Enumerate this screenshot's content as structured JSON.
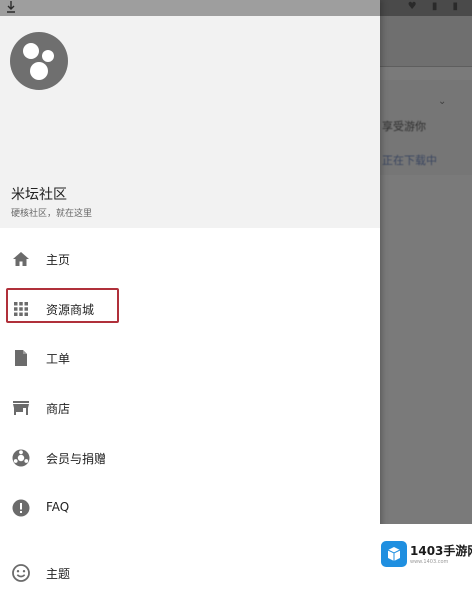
{
  "background_app": {
    "text_line_1": "享受游你",
    "text_line_2": "正在下载中"
  },
  "drawer": {
    "title": "米坛社区",
    "subtitle": "硬核社区，就在这里",
    "menu": [
      {
        "label": "主页",
        "icon": "home-icon"
      },
      {
        "label": "资源商城",
        "icon": "grid-icon"
      },
      {
        "label": "工单",
        "icon": "document-icon"
      },
      {
        "label": "商店",
        "icon": "storefront-icon"
      },
      {
        "label": "会员与捐赠",
        "icon": "support-icon"
      },
      {
        "label": "FAQ",
        "icon": "info-icon"
      },
      {
        "label": "主题",
        "icon": "smiley-icon"
      }
    ],
    "highlighted_item": "资源商城"
  },
  "watermark": {
    "brand": "1403手游网",
    "url": "www.1403.com"
  },
  "colors": {
    "drawer_bg": "#ffffff",
    "header_bg": "#f2f2f2",
    "icon_gray": "#6b6b6b",
    "highlight_border": "#b0303a",
    "watermark_blue": "#1f8fe0"
  }
}
